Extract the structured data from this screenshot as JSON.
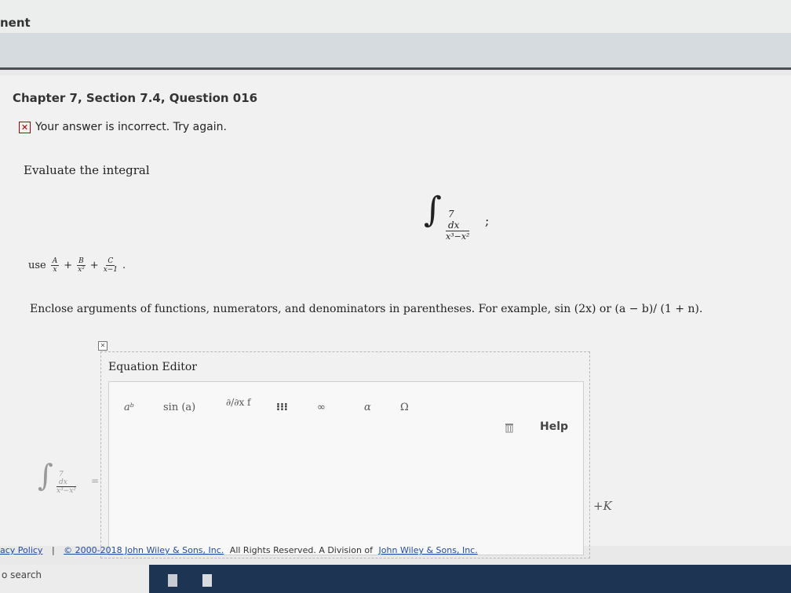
{
  "header": {
    "title_fragment": "nent"
  },
  "question": {
    "title": "Chapter 7, Section 7.4, Question 016"
  },
  "status": {
    "icon": "x-box-icon",
    "message": "Your answer is incorrect.  Try again."
  },
  "problem": {
    "prompt": "Evaluate the integral",
    "integrand_numerator": "7 dx",
    "integrand_denominator": "x³−x²",
    "integral_trailer": ";",
    "hint_prefix": "use",
    "hint_terms": [
      {
        "num": "A",
        "den": "x"
      },
      {
        "num": "B",
        "den": "x²"
      },
      {
        "num": "C",
        "den": "x−1"
      }
    ],
    "hint_plus": "+",
    "hint_end": "."
  },
  "instructions": "Enclose arguments of functions, numerators, and denominators in parentheses. For example, sin (2x) or (a − b)/ (1 + n).",
  "editor": {
    "label": "Equation Editor",
    "toolbar": [
      "aᵇ",
      "sin (a)",
      "∂/∂x f",
      "⁝⁝⁝",
      "∞",
      "α",
      "Ω",
      "trash-icon",
      "Help"
    ],
    "lhs_numerator": "7 dx",
    "lhs_denominator": "x³−x²",
    "equals": "=",
    "constant": "+K"
  },
  "footer": {
    "privacy": "acy Policy",
    "sep": "|",
    "copyright": "© 2000-2018 John Wiley & Sons, Inc.",
    "rights": "All Rights Reserved. A Division of",
    "company": "John Wiley & Sons, Inc."
  },
  "taskbar": {
    "search": "o search"
  }
}
